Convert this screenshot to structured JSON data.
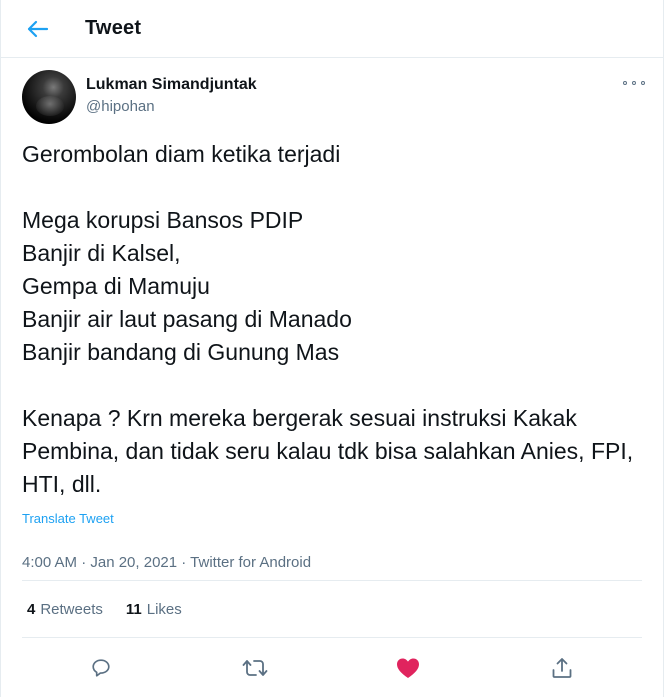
{
  "topbar": {
    "title": "Tweet",
    "back_icon": "arrow-left-icon"
  },
  "author": {
    "name": "Lukman Simandjuntak",
    "handle": "@hipohan"
  },
  "tweet": {
    "text": "Gerombolan diam ketika terjadi\n\nMega korupsi Bansos PDIP\nBanjir di Kalsel,\nGempa di Mamuju\nBanjir air laut pasang di Manado\nBanjir bandang di Gunung Mas\n\nKenapa ? Krn mereka bergerak sesuai instruksi Kakak Pembina, dan tidak seru kalau tdk bisa salahkan Anies, FPI, HTI, dll.",
    "translate_label": "Translate Tweet",
    "meta": "4:00 AM · Jan 20, 2021 · Twitter for Android"
  },
  "stats": {
    "retweets_count": "4",
    "retweets_label": "Retweets",
    "likes_count": "11",
    "likes_label": "Likes"
  },
  "actions": [
    "reply-icon",
    "retweet-icon",
    "like-icon",
    "share-icon"
  ],
  "colors": {
    "accent": "#1da1f2",
    "like": "#e0245e",
    "muted": "#5b7083",
    "text": "#0f1419",
    "border": "#e6ecf0"
  }
}
